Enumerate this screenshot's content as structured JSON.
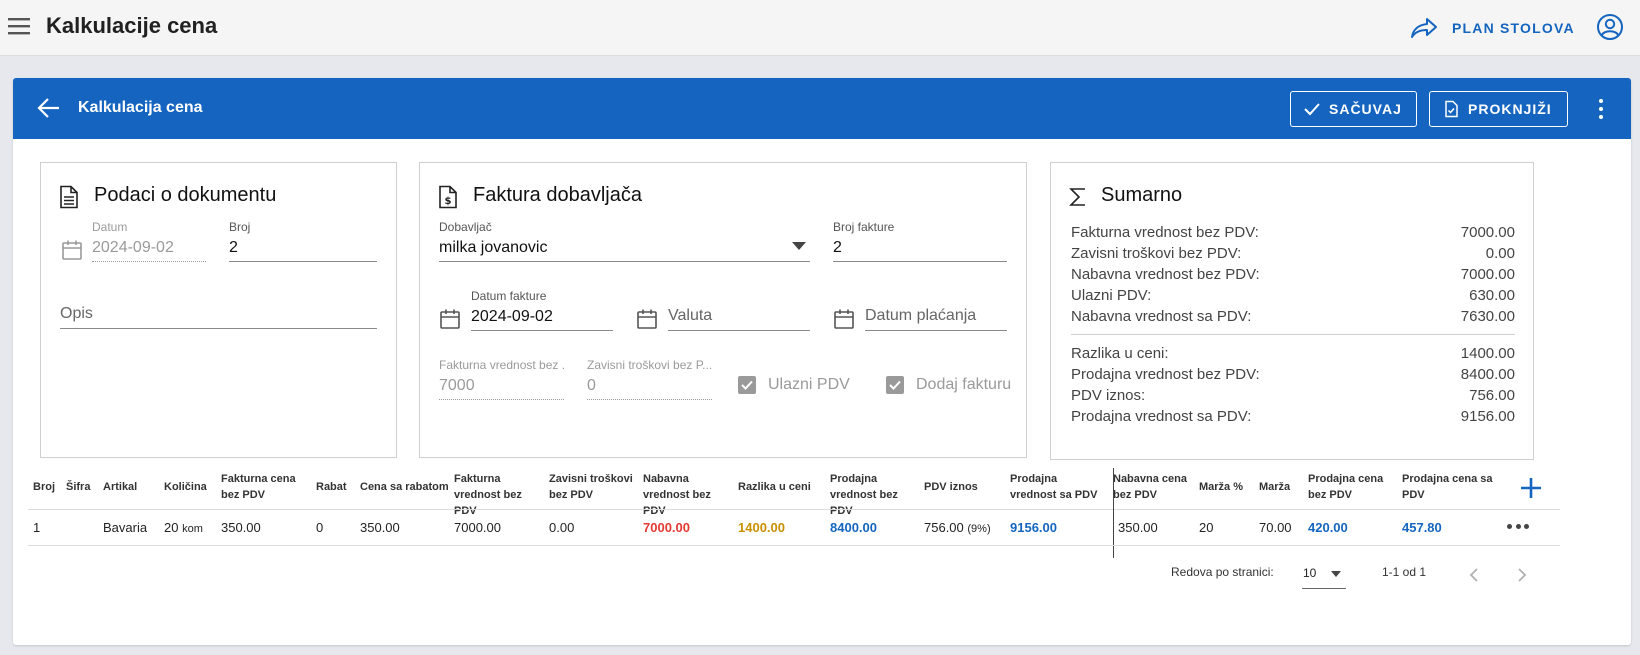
{
  "app": {
    "title": "Kalkulacije cena",
    "plan_label": "PLAN STOLOVA"
  },
  "header": {
    "title": "Kalkulacija cena",
    "save_label": "SAČUVAJ",
    "post_label": "PROKNJIŽI"
  },
  "doc": {
    "title": "Podaci o dokumentu",
    "date_label": "Datum",
    "date_value": "2024-09-02",
    "number_label": "Broj",
    "number_value": "2",
    "desc_placeholder": "Opis"
  },
  "invoice": {
    "title": "Faktura dobavljača",
    "supplier_label": "Dobavljač",
    "supplier_value": "milka jovanovic",
    "invoice_no_label": "Broj fakture",
    "invoice_no_value": "2",
    "invoice_date_label": "Datum fakture",
    "invoice_date_value": "2024-09-02",
    "currency_placeholder": "Valuta",
    "payment_date_placeholder": "Datum plaćanja",
    "invoice_value_label": "Fakturna vrednost bez ...",
    "invoice_value": "7000",
    "dep_costs_label": "Zavisni troškovi bez P...",
    "dep_costs_value": "0",
    "input_vat_label": "Ulazni PDV",
    "input_vat_checked": true,
    "add_invoice_label": "Dodaj fakturu",
    "add_invoice_checked": true
  },
  "summary": {
    "title": "Sumarno",
    "rows": [
      {
        "label": "Fakturna vrednost bez PDV:",
        "value": "7000.00"
      },
      {
        "label": "Zavisni troškovi bez PDV:",
        "value": "0.00"
      },
      {
        "label": "Nabavna vrednost bez PDV:",
        "value": "7000.00"
      },
      {
        "label": "Ulazni PDV:",
        "value": "630.00"
      },
      {
        "label": "Nabavna vrednost sa PDV:",
        "value": "7630.00"
      },
      {
        "label": "Razlika u ceni:",
        "value": "1400.00"
      },
      {
        "label": "Prodajna vrednost bez PDV:",
        "value": "8400.00"
      },
      {
        "label": "PDV iznos:",
        "value": "756.00"
      },
      {
        "label": "Prodajna vrednost sa PDV:",
        "value": "9156.00"
      }
    ]
  },
  "table": {
    "headers": [
      "Broj",
      "Šifra",
      "Artikal",
      "Količina",
      "Fakturna cena bez PDV",
      "Rabat",
      "Cena sa rabatom",
      "Fakturna vrednost bez PDV",
      "Zavisni troškovi bez PDV",
      "Nabavna vrednost bez PDV",
      "Razlika u ceni",
      "Prodajna vrednost bez PDV",
      "PDV iznos",
      "Prodajna vrednost sa PDV",
      "Nabavna cena bez PDV",
      "Marža %",
      "Marža",
      "Prodajna cena bez PDV",
      "Prodajna cena sa PDV"
    ],
    "rows": [
      {
        "broj": "1",
        "sifra": "",
        "artikal": "Bavaria",
        "kolicina": "20",
        "jedinica": "kom",
        "fakturna_cena": "350.00",
        "rabat": "0",
        "cena_sa_rabatom": "350.00",
        "fakturna_vrednost": "7000.00",
        "zavisni_troskovi": "0.00",
        "nabavna_vrednost": "7000.00",
        "razlika_u_ceni": "1400.00",
        "prodajna_vrednost_bez": "8400.00",
        "pdv_iznos": "756.00",
        "pdv_stopa": "(9%)",
        "prodajna_vrednost_sa": "9156.00",
        "nabavna_cena": "350.00",
        "marza_pct": "20",
        "marza": "70.00",
        "prodajna_cena_bez": "420.00",
        "prodajna_cena_sa": "457.80"
      }
    ],
    "rows_per_page_label": "Redova po stranici:",
    "rows_per_page": "10",
    "range": "1-1 od 1"
  },
  "colors": {
    "primary": "#1565c0",
    "red_value": "#e53935",
    "amber_value": "#c79100",
    "blue_value": "#1565c0"
  },
  "icons": [
    "menu-icon",
    "reply-arrow-icon",
    "account-circle-icon",
    "arrow-left-icon",
    "check-icon",
    "document-check-icon",
    "more-vert-icon",
    "document-icon",
    "invoice-dollar-icon",
    "sigma-icon",
    "calendar-icon",
    "dropdown-arrow-icon",
    "checkbox-icon",
    "plus-icon",
    "more-horiz-icon",
    "chevron-left-icon",
    "chevron-right-icon"
  ]
}
